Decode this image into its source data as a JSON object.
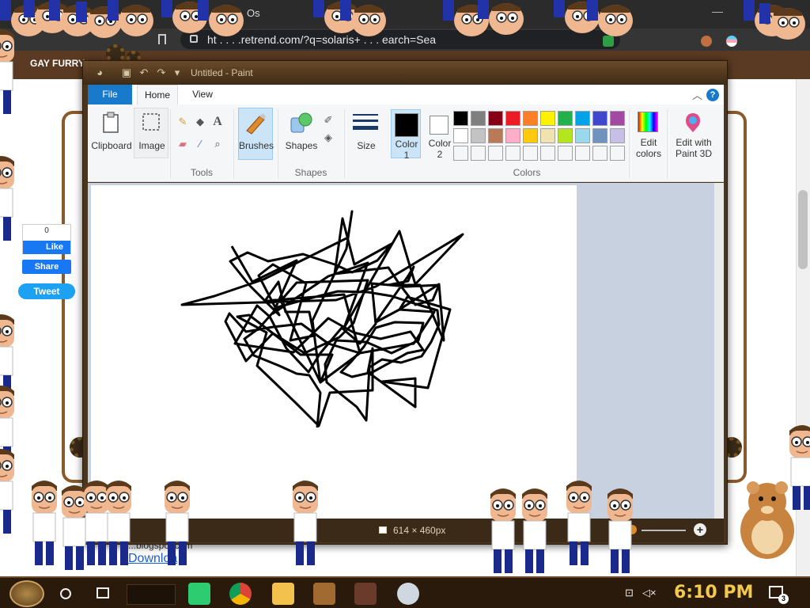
{
  "browser": {
    "tab_title": "Os",
    "url": "ht . . . .retrend.com/?q=solaris+ . . . earch=Sea",
    "page_header": "GAY FURRY"
  },
  "page": {
    "fb_count": "0",
    "fb_like": "Like",
    "fb_share": "Share",
    "tweet": "Tweet",
    "link_partial": "...blogspot.com",
    "download_link": "Downloa"
  },
  "paint": {
    "title": "Untitled - Paint",
    "tabs": [
      "File",
      "Home",
      "View"
    ],
    "help": "?",
    "groups": {
      "clipboard": "Clipboard",
      "image": "Image",
      "tools": "Tools",
      "brushes": "Brushes",
      "shapes_btn": "Shapes",
      "shapes": "Shapes",
      "size": "Size",
      "color1_line1": "Color",
      "color1_line2": "1",
      "color2_line1": "Color",
      "color2_line2": "2",
      "colors": "Colors",
      "edit_colors_line1": "Edit",
      "edit_colors_line2": "colors",
      "paint3d_line1": "Edit with",
      "paint3d_line2": "Paint 3D"
    },
    "palette_row1": [
      "#000000",
      "#7f7f7f",
      "#880015",
      "#ed1c24",
      "#ff7f27",
      "#fff200",
      "#22b14c",
      "#00a2e8",
      "#3f48cc",
      "#a349a4"
    ],
    "palette_row2": [
      "#ffffff",
      "#c3c3c3",
      "#b97a57",
      "#ffaec9",
      "#ffc90e",
      "#efe4b0",
      "#b5e61d",
      "#99d9ea",
      "#7092be",
      "#c8bfe7"
    ],
    "color1": "#000000",
    "color2": "#ffffff",
    "canvas_size": "614 × 460px"
  },
  "taskbar": {
    "clock": "6:10 PM",
    "notification_count": "3"
  }
}
